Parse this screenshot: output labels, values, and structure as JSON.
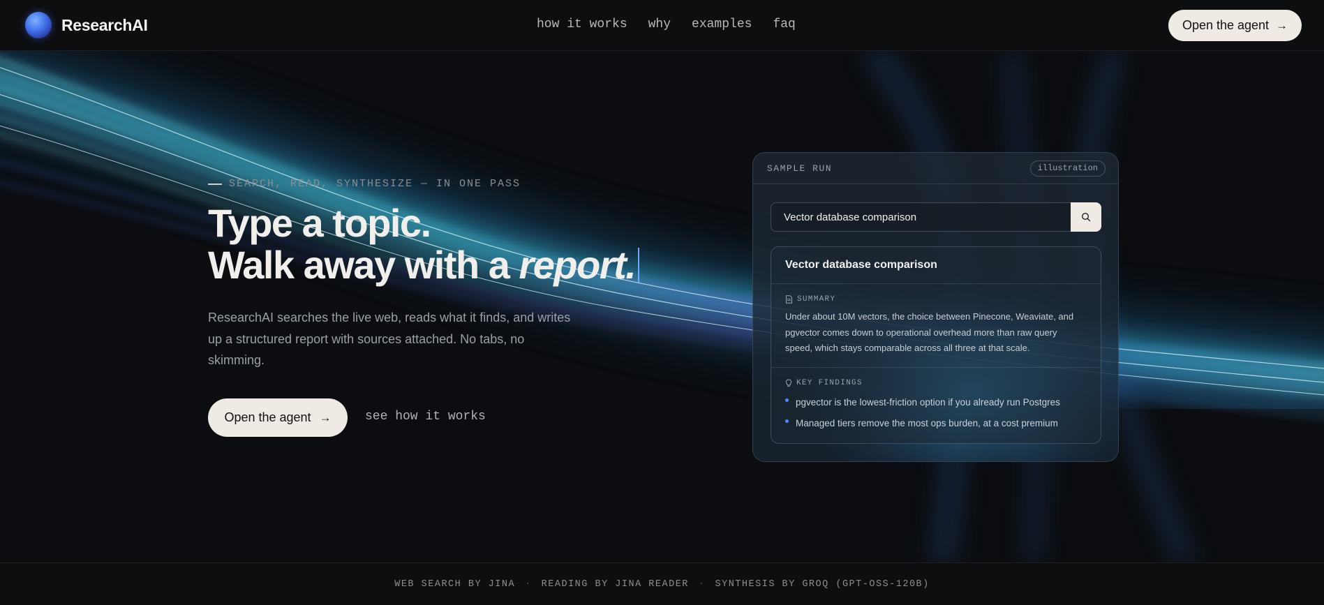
{
  "brand": {
    "name": "ResearchAI"
  },
  "nav": {
    "items": [
      {
        "label": "how it works"
      },
      {
        "label": "why"
      },
      {
        "label": "examples"
      },
      {
        "label": "faq"
      }
    ],
    "cta_label": "Open the agent"
  },
  "hero": {
    "eyebrow": "SEARCH, READ, SYNTHESIZE — IN ONE PASS",
    "headline_line1": "Type a topic.",
    "headline_line2_prefix": "Walk away with a ",
    "headline_line2_emphasis": "report.",
    "lede": "ResearchAI searches the live web, reads what it finds, and writes up a structured report with sources attached. No tabs, no skimming.",
    "primary_cta": "Open the agent",
    "secondary_cta": "see how it works"
  },
  "sample": {
    "title": "SAMPLE RUN",
    "badge": "illustration",
    "query": "Vector database comparison",
    "report_title": "Vector database comparison",
    "summary_label": "SUMMARY",
    "summary": "Under about 10M vectors, the choice between Pinecone, Weaviate, and pgvector comes down to operational overhead more than raw query speed, which stays comparable across all three at that scale.",
    "findings_label": "KEY FINDINGS",
    "findings": [
      "pgvector is the lowest-friction option if you already run Postgres",
      "Managed tiers remove the most ops burden, at a cost premium"
    ]
  },
  "footer": {
    "items": [
      "WEB SEARCH BY JINA",
      "READING BY JINA READER",
      "SYNTHESIS BY GROQ (GPT-OSS-120B)"
    ],
    "separator": "·"
  },
  "colors": {
    "background": "#0b0d10",
    "cta_background": "#efebe4",
    "accent_blue": "#4d8cff",
    "wave_cyan": "#5fe3e0",
    "wave_violet": "#8a6cff"
  },
  "icons": {
    "arrow": "arrow-right-icon",
    "search": "search-icon",
    "summary": "document-icon",
    "findings": "bulb-icon"
  }
}
